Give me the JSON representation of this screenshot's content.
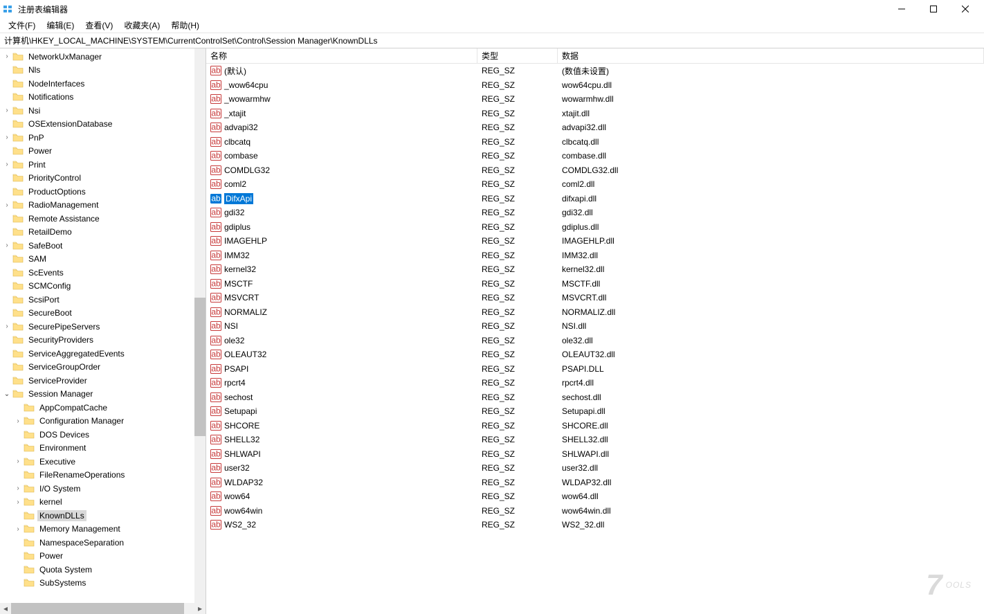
{
  "window": {
    "title": "注册表编辑器"
  },
  "menubar": {
    "items": [
      {
        "label": "文件(F)"
      },
      {
        "label": "编辑(E)"
      },
      {
        "label": "查看(V)"
      },
      {
        "label": "收藏夹(A)"
      },
      {
        "label": "帮助(H)"
      }
    ]
  },
  "addressbar": {
    "path": "计算机\\HKEY_LOCAL_MACHINE\\SYSTEM\\CurrentControlSet\\Control\\Session Manager\\KnownDLLs"
  },
  "tree": {
    "items": [
      {
        "level": 1,
        "expand": "closed",
        "label": "NetworkUxManager"
      },
      {
        "level": 1,
        "expand": "none",
        "label": "Nls"
      },
      {
        "level": 1,
        "expand": "none",
        "label": "NodeInterfaces"
      },
      {
        "level": 1,
        "expand": "none",
        "label": "Notifications"
      },
      {
        "level": 1,
        "expand": "closed",
        "label": "Nsi"
      },
      {
        "level": 1,
        "expand": "none",
        "label": "OSExtensionDatabase"
      },
      {
        "level": 1,
        "expand": "closed",
        "label": "PnP"
      },
      {
        "level": 1,
        "expand": "none",
        "label": "Power"
      },
      {
        "level": 1,
        "expand": "closed",
        "label": "Print"
      },
      {
        "level": 1,
        "expand": "none",
        "label": "PriorityControl"
      },
      {
        "level": 1,
        "expand": "none",
        "label": "ProductOptions"
      },
      {
        "level": 1,
        "expand": "closed",
        "label": "RadioManagement"
      },
      {
        "level": 1,
        "expand": "none",
        "label": "Remote Assistance"
      },
      {
        "level": 1,
        "expand": "none",
        "label": "RetailDemo"
      },
      {
        "level": 1,
        "expand": "closed",
        "label": "SafeBoot"
      },
      {
        "level": 1,
        "expand": "none",
        "label": "SAM"
      },
      {
        "level": 1,
        "expand": "none",
        "label": "ScEvents"
      },
      {
        "level": 1,
        "expand": "none",
        "label": "SCMConfig"
      },
      {
        "level": 1,
        "expand": "none",
        "label": "ScsiPort"
      },
      {
        "level": 1,
        "expand": "none",
        "label": "SecureBoot"
      },
      {
        "level": 1,
        "expand": "closed",
        "label": "SecurePipeServers"
      },
      {
        "level": 1,
        "expand": "none",
        "label": "SecurityProviders"
      },
      {
        "level": 1,
        "expand": "none",
        "label": "ServiceAggregatedEvents"
      },
      {
        "level": 1,
        "expand": "none",
        "label": "ServiceGroupOrder"
      },
      {
        "level": 1,
        "expand": "none",
        "label": "ServiceProvider"
      },
      {
        "level": 1,
        "expand": "open",
        "label": "Session Manager"
      },
      {
        "level": 2,
        "expand": "none",
        "label": "AppCompatCache"
      },
      {
        "level": 2,
        "expand": "closed",
        "label": "Configuration Manager"
      },
      {
        "level": 2,
        "expand": "none",
        "label": "DOS Devices"
      },
      {
        "level": 2,
        "expand": "none",
        "label": "Environment"
      },
      {
        "level": 2,
        "expand": "closed",
        "label": "Executive"
      },
      {
        "level": 2,
        "expand": "none",
        "label": "FileRenameOperations"
      },
      {
        "level": 2,
        "expand": "closed",
        "label": "I/O System"
      },
      {
        "level": 2,
        "expand": "closed",
        "label": "kernel"
      },
      {
        "level": 2,
        "expand": "none",
        "label": "KnownDLLs",
        "selected": true
      },
      {
        "level": 2,
        "expand": "closed",
        "label": "Memory Management"
      },
      {
        "level": 2,
        "expand": "none",
        "label": "NamespaceSeparation"
      },
      {
        "level": 2,
        "expand": "none",
        "label": "Power"
      },
      {
        "level": 2,
        "expand": "none",
        "label": "Quota System"
      },
      {
        "level": 2,
        "expand": "none",
        "label": "SubSystems"
      }
    ]
  },
  "values": {
    "columns": {
      "name": "名称",
      "type": "类型",
      "data": "数据"
    },
    "rows": [
      {
        "name": "(默认)",
        "type": "REG_SZ",
        "data": "(数值未设置)"
      },
      {
        "name": "_wow64cpu",
        "type": "REG_SZ",
        "data": "wow64cpu.dll"
      },
      {
        "name": "_wowarmhw",
        "type": "REG_SZ",
        "data": "wowarmhw.dll"
      },
      {
        "name": "_xtajit",
        "type": "REG_SZ",
        "data": "xtajit.dll"
      },
      {
        "name": "advapi32",
        "type": "REG_SZ",
        "data": "advapi32.dll"
      },
      {
        "name": "clbcatq",
        "type": "REG_SZ",
        "data": "clbcatq.dll"
      },
      {
        "name": "combase",
        "type": "REG_SZ",
        "data": "combase.dll"
      },
      {
        "name": "COMDLG32",
        "type": "REG_SZ",
        "data": "COMDLG32.dll"
      },
      {
        "name": "coml2",
        "type": "REG_SZ",
        "data": "coml2.dll"
      },
      {
        "name": "DifxApi",
        "type": "REG_SZ",
        "data": "difxapi.dll",
        "selected": true
      },
      {
        "name": "gdi32",
        "type": "REG_SZ",
        "data": "gdi32.dll"
      },
      {
        "name": "gdiplus",
        "type": "REG_SZ",
        "data": "gdiplus.dll"
      },
      {
        "name": "IMAGEHLP",
        "type": "REG_SZ",
        "data": "IMAGEHLP.dll"
      },
      {
        "name": "IMM32",
        "type": "REG_SZ",
        "data": "IMM32.dll"
      },
      {
        "name": "kernel32",
        "type": "REG_SZ",
        "data": "kernel32.dll"
      },
      {
        "name": "MSCTF",
        "type": "REG_SZ",
        "data": "MSCTF.dll"
      },
      {
        "name": "MSVCRT",
        "type": "REG_SZ",
        "data": "MSVCRT.dll"
      },
      {
        "name": "NORMALIZ",
        "type": "REG_SZ",
        "data": "NORMALIZ.dll"
      },
      {
        "name": "NSI",
        "type": "REG_SZ",
        "data": "NSI.dll"
      },
      {
        "name": "ole32",
        "type": "REG_SZ",
        "data": "ole32.dll"
      },
      {
        "name": "OLEAUT32",
        "type": "REG_SZ",
        "data": "OLEAUT32.dll"
      },
      {
        "name": "PSAPI",
        "type": "REG_SZ",
        "data": "PSAPI.DLL"
      },
      {
        "name": "rpcrt4",
        "type": "REG_SZ",
        "data": "rpcrt4.dll"
      },
      {
        "name": "sechost",
        "type": "REG_SZ",
        "data": "sechost.dll"
      },
      {
        "name": "Setupapi",
        "type": "REG_SZ",
        "data": "Setupapi.dll"
      },
      {
        "name": "SHCORE",
        "type": "REG_SZ",
        "data": "SHCORE.dll"
      },
      {
        "name": "SHELL32",
        "type": "REG_SZ",
        "data": "SHELL32.dll"
      },
      {
        "name": "SHLWAPI",
        "type": "REG_SZ",
        "data": "SHLWAPI.dll"
      },
      {
        "name": "user32",
        "type": "REG_SZ",
        "data": "user32.dll"
      },
      {
        "name": "WLDAP32",
        "type": "REG_SZ",
        "data": "WLDAP32.dll"
      },
      {
        "name": "wow64",
        "type": "REG_SZ",
        "data": "wow64.dll"
      },
      {
        "name": "wow64win",
        "type": "REG_SZ",
        "data": "wow64win.dll"
      },
      {
        "name": "WS2_32",
        "type": "REG_SZ",
        "data": "WS2_32.dll"
      }
    ]
  },
  "watermark": "OOLS"
}
